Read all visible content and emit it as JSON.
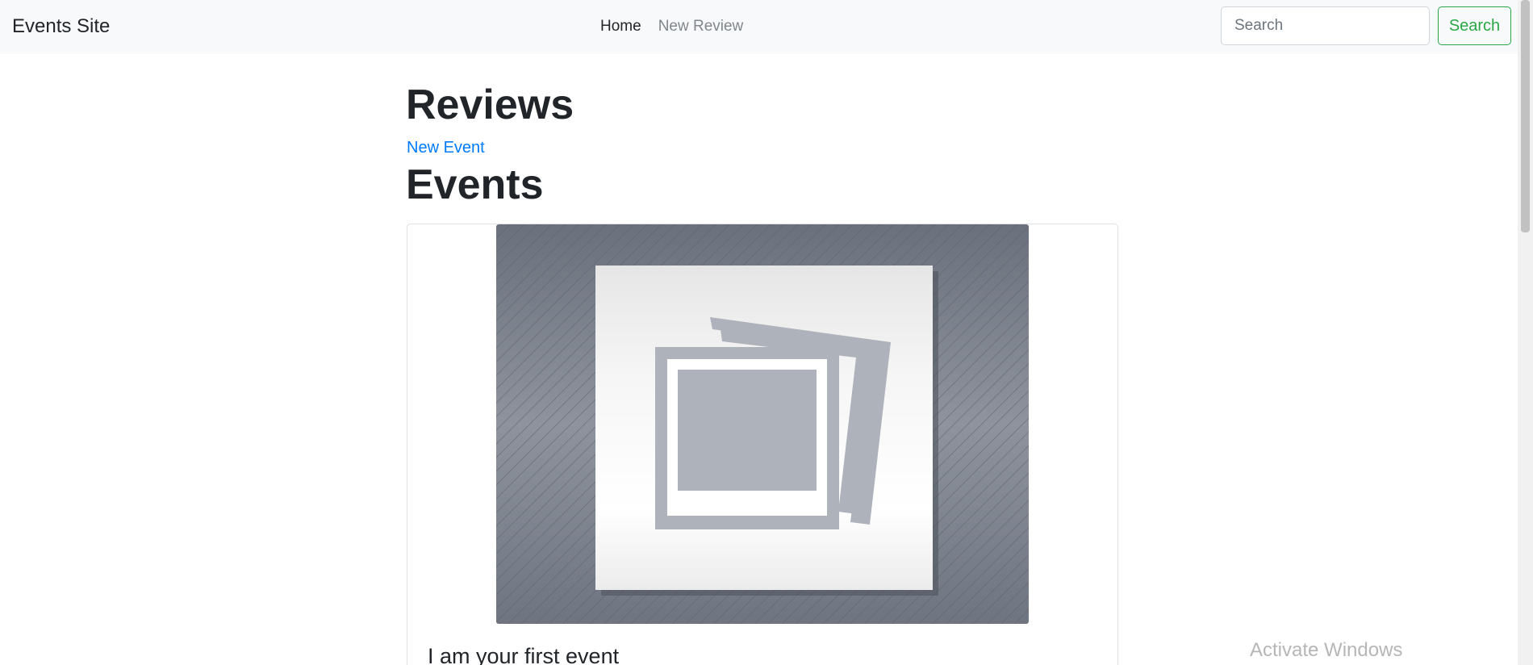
{
  "navbar": {
    "brand": "Events Site",
    "links": [
      {
        "label": "Home",
        "active": true
      },
      {
        "label": "New Review",
        "active": false
      }
    ],
    "search": {
      "placeholder": "Search",
      "value": ""
    },
    "search_button": "Search"
  },
  "main": {
    "reviews_heading": "Reviews",
    "new_event_link": "New Event",
    "events_heading": "Events",
    "events": [
      {
        "title": "I am your first event",
        "image": "placeholder-image-icon"
      }
    ]
  },
  "overlay": {
    "activate_windows": "Activate Windows"
  },
  "colors": {
    "navbar_bg": "#f8f9fa",
    "link_blue": "#007bff",
    "success_green": "#28a745",
    "muted_nav": "#80868b",
    "image_bg": "#7c828e"
  }
}
